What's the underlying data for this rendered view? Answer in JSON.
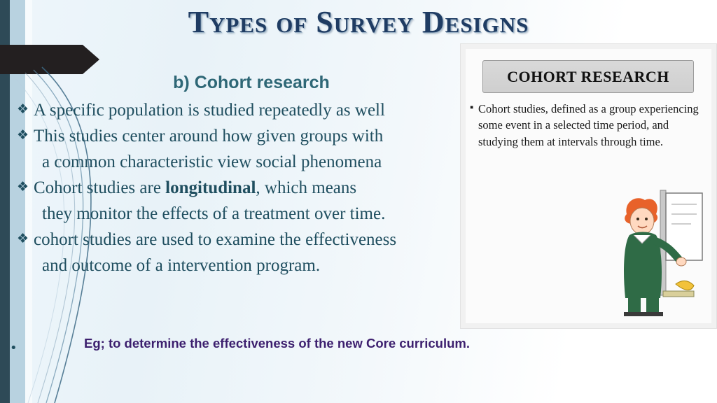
{
  "slide": {
    "title": "Types of Survey Designs",
    "subhead": "b) Cohort research",
    "bullets": [
      {
        "marker": "❖",
        "text": "A specific population is studied repeatedly as well",
        "indent": false
      },
      {
        "marker": "❖",
        "text": "This studies center around how given groups with",
        "indent": false
      },
      {
        "marker": "",
        "text": "a common characteristic  view social phenomena",
        "indent": true
      },
      {
        "marker": "❖",
        "text_before": "Cohort studies are ",
        "bold": "longitudinal",
        "text_after": ", which means",
        "indent": false
      },
      {
        "marker": "",
        "text": "they monitor the effects of a treatment over time.",
        "indent": true
      },
      {
        "marker": "❖",
        "text": "cohort studies are used to examine the effectiveness",
        "indent": false
      },
      {
        "marker": "",
        "text": "and outcome of a  intervention  program.",
        "indent": true
      }
    ],
    "example_marker": "•",
    "example": "Eg; to determine the effectiveness of the new Core curriculum.",
    "colors": {
      "body_text": "#1f4e5f",
      "title": "#1f3c63",
      "subhead": "#2e6776",
      "example": "#3c1f6e",
      "left_bar_dark": "#2e4a57",
      "left_bar_light": "#b8d2e0",
      "banner": "#231f20"
    }
  },
  "image_card": {
    "header": "COHORT RESEARCH",
    "bullet_marker": "▪",
    "body": "Cohort studies, defined as a group experiencing some event in a selected time period, and studying them at intervals through time.",
    "illustration": "cartoon-researcher-at-board"
  }
}
